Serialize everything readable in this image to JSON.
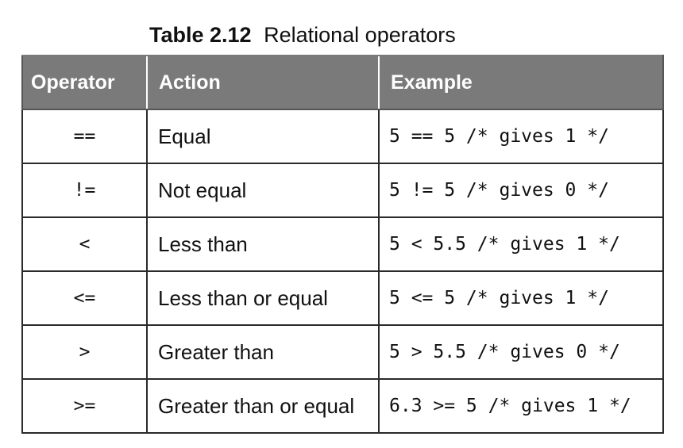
{
  "caption": {
    "number": "Table 2.12",
    "title": "Relational operators"
  },
  "table": {
    "headers": [
      "Operator",
      "Action",
      "Example"
    ],
    "rows": [
      {
        "operator": "==",
        "action": "Equal",
        "example": "5 == 5 /* gives 1 */"
      },
      {
        "operator": "!=",
        "action": "Not equal",
        "example": "5 != 5 /* gives 0 */"
      },
      {
        "operator": "<",
        "action": "Less than",
        "example": "5 < 5.5 /* gives 1 */"
      },
      {
        "operator": "<=",
        "action": "Less than or equal",
        "example": "5 <= 5 /* gives 1 */"
      },
      {
        "operator": ">",
        "action": "Greater than",
        "example": "5 > 5.5 /* gives 0 */"
      },
      {
        "operator": ">=",
        "action": "Greater than or equal",
        "example": "6.3 >= 5 /* gives 1 */"
      }
    ]
  }
}
